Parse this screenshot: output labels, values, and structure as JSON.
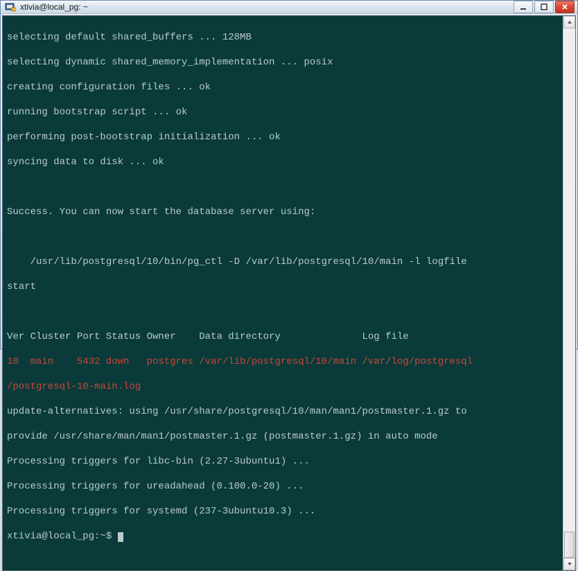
{
  "window": {
    "title": "xtivia@local_pg: ~"
  },
  "terminal": {
    "lines": {
      "l0": "selecting default shared_buffers ... 128MB",
      "l1": "selecting dynamic shared_memory_implementation ... posix",
      "l2": "creating configuration files ... ok",
      "l3": "running bootstrap script ... ok",
      "l4": "performing post-bootstrap initialization ... ok",
      "l5": "syncing data to disk ... ok",
      "l6": "",
      "l7": "Success. You can now start the database server using:",
      "l8": "",
      "l9": "    /usr/lib/postgresql/10/bin/pg_ctl -D /var/lib/postgresql/10/main -l logfile ",
      "l10": "start",
      "l11": "",
      "l12": "Ver Cluster Port Status Owner    Data directory              Log file",
      "l13_red": "10  main    5432 down   postgres /var/lib/postgresql/10/main /var/log/postgresql",
      "l14_red": "/postgresql-10-main.log",
      "l15": "update-alternatives: using /usr/share/postgresql/10/man/man1/postmaster.1.gz to ",
      "l16": "provide /usr/share/man/man1/postmaster.1.gz (postmaster.1.gz) in auto mode",
      "l17": "Processing triggers for libc-bin (2.27-3ubuntu1) ...",
      "l18": "Processing triggers for ureadahead (0.100.0-20) ...",
      "l19": "Processing triggers for systemd (237-3ubuntu10.3) ...",
      "prompt": "xtivia@local_pg:~$ "
    }
  }
}
